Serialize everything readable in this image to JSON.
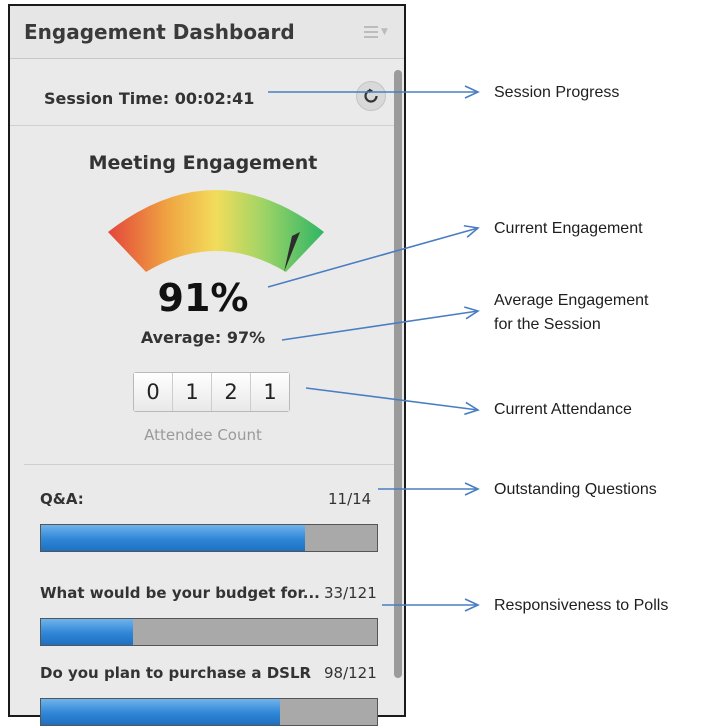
{
  "panel": {
    "title": "Engagement Dashboard",
    "session_time_label": "Session Time:",
    "session_time_value": "00:02:41",
    "meeting_title": "Meeting Engagement",
    "current_engagement": "91%",
    "current_engagement_value": 0.91,
    "average_label": "Average: 97%",
    "attendee_digits": [
      "0",
      "1",
      "2",
      "1"
    ],
    "attendee_label": "Attendee Count",
    "qa": {
      "label": "Q&A:",
      "value": "11/14",
      "fraction": 0.786
    },
    "polls": [
      {
        "label": "What would be your budget for...",
        "value": "33/121",
        "fraction": 0.273
      },
      {
        "label": "Do you plan to purchase a DSLR",
        "value": "98/121",
        "fraction": 0.71
      }
    ]
  },
  "annotations": {
    "session_progress": "Session Progress",
    "current_engagement": "Current Engagement",
    "average_engagement_line1": "Average Engagement",
    "average_engagement_line2": "for the Session",
    "current_attendance": "Current Attendance",
    "outstanding_questions": "Outstanding Questions",
    "responsiveness_polls": "Responsiveness to Polls"
  },
  "colors": {
    "bar_fill": "#2f86d6",
    "bar_track": "#a9a9a9",
    "arrow": "#4a7ec2"
  }
}
